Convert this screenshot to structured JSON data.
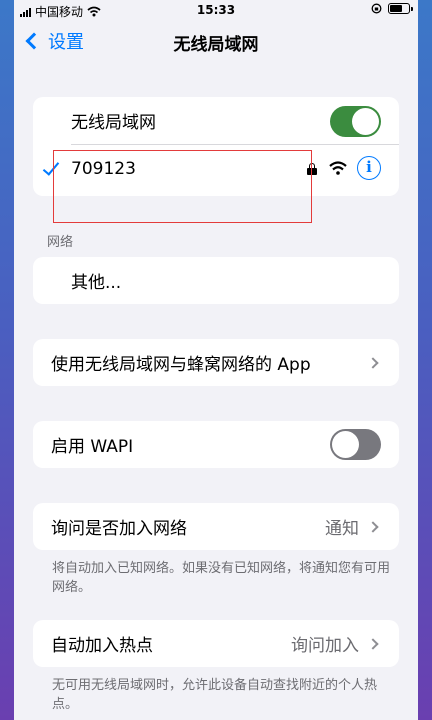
{
  "status_bar": {
    "carrier": "中国移动",
    "time": "15:33"
  },
  "nav": {
    "back_label": "设置",
    "title": "无线局域网"
  },
  "wlan": {
    "label": "无线局域网",
    "enabled": true,
    "connected_network": "709123"
  },
  "networks": {
    "section_label": "网络",
    "other_label": "其他..."
  },
  "apps_row": {
    "label": "使用无线局域网与蜂窝网络的 App"
  },
  "wapi": {
    "label": "启用 WAPI",
    "enabled": false
  },
  "ask_join": {
    "label": "询问是否加入网络",
    "value": "通知",
    "footnote": "将自动加入已知网络。如果没有已知网络，将通知您有可用网络。"
  },
  "auto_hotspot": {
    "label": "自动加入热点",
    "value": "询问加入",
    "footnote": "无可用无线局域网时，允许此设备自动查找附近的个人热点。"
  },
  "colors": {
    "accent": "#007aff",
    "toggle_on": "#3b8c3f",
    "annotation": "#e33b3b"
  }
}
